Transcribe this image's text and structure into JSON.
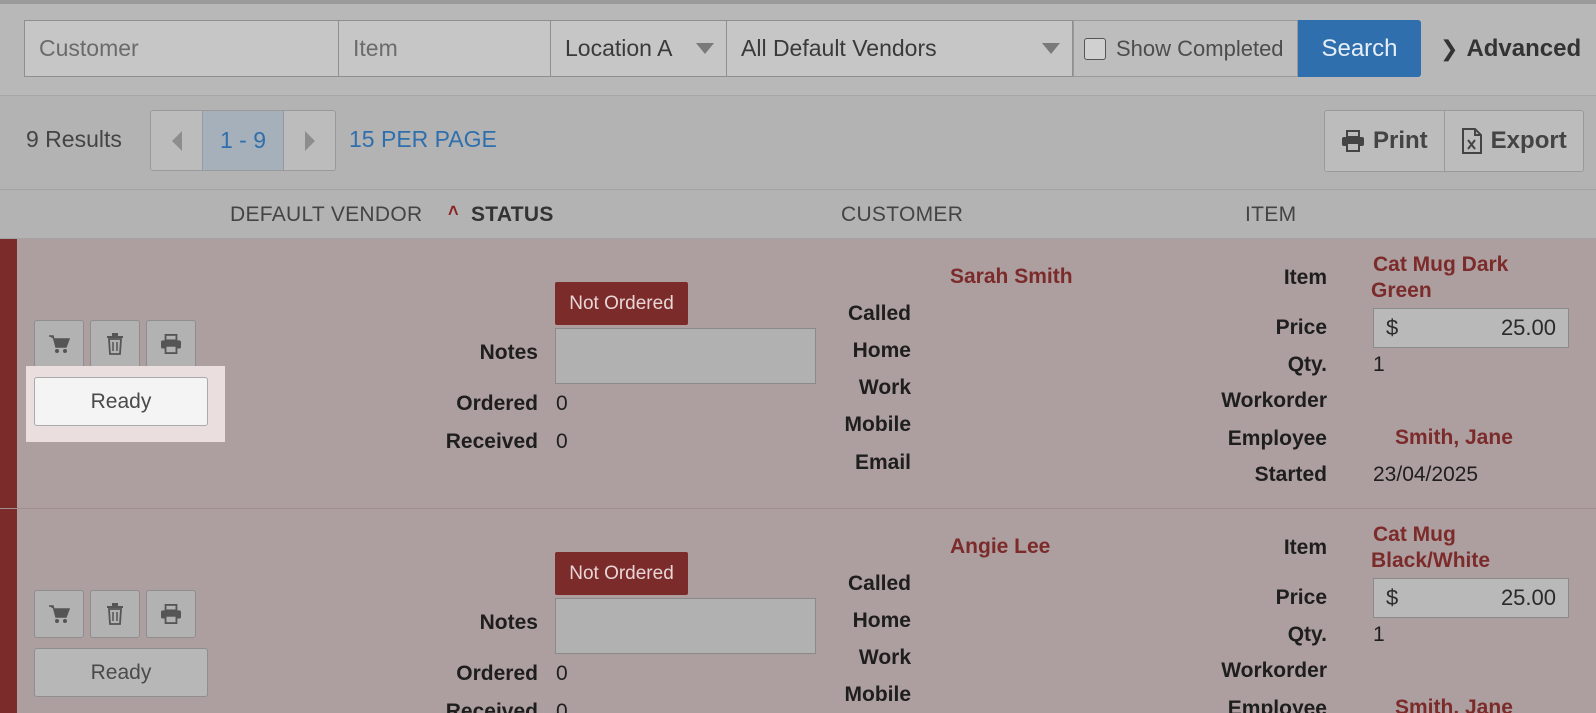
{
  "filters": {
    "customer_placeholder": "Customer",
    "item_placeholder": "Item",
    "location_value": "Location A",
    "vendor_value": "All Default Vendors",
    "show_completed_label": "Show Completed",
    "search_label": "Search",
    "advanced_label": "Advanced"
  },
  "results": {
    "count_label": "9 Results",
    "page_range": "1 - 9",
    "per_page_label": "15 PER PAGE",
    "print_label": "Print",
    "export_label": "Export"
  },
  "columns": {
    "vendor": "DEFAULT VENDOR",
    "status": "STATUS",
    "customer": "CUSTOMER",
    "item": "ITEM"
  },
  "labels": {
    "notes": "Notes",
    "ordered": "Ordered",
    "received": "Received",
    "called": "Called",
    "home": "Home",
    "work": "Work",
    "mobile": "Mobile",
    "email": "Email",
    "item": "Item",
    "price": "Price",
    "qty": "Qty.",
    "workorder": "Workorder",
    "employee": "Employee",
    "started": "Started",
    "currency": "$",
    "ready": "Ready"
  },
  "rows": [
    {
      "status": "Not Ordered",
      "ordered": "0",
      "received": "0",
      "customer": "Sarah Smith",
      "item_line1": "Cat Mug Dark",
      "item_line2": "Green",
      "price": "25.00",
      "qty": "1",
      "employee": "Smith, Jane",
      "started": "23/04/2025"
    },
    {
      "status": "Not Ordered",
      "ordered": "0",
      "received": "0",
      "customer": "Angie Lee",
      "item_line1": "Cat Mug",
      "item_line2": "Black/White",
      "price": "25.00",
      "qty": "1",
      "employee": "Smith, Jane"
    }
  ],
  "colors": {
    "accent_blue": "#2f6fad",
    "status_red": "#7c2b2b"
  }
}
